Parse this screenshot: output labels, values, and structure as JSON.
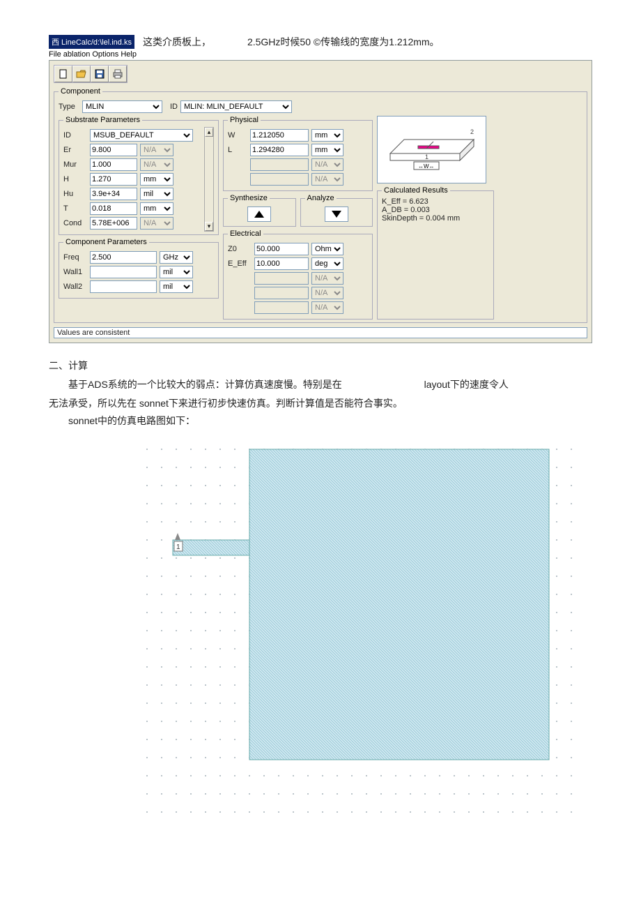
{
  "window": {
    "title": "西  LineCalc/d:\\lel.ind.ks",
    "caption_rest": "这类介质板上，",
    "caption_tail": "2.5GHz时候50 ©传输线的宽度为1.212mm。",
    "menubar": "File ablation Options Help"
  },
  "toolbar_icons": [
    "new-icon",
    "open-icon",
    "save-icon",
    "print-icon"
  ],
  "component": {
    "legend": "Component",
    "type_label": "Type",
    "type_value": "MLIN",
    "id_label": "ID",
    "id_value": "MLIN: MLIN_DEFAULT"
  },
  "substrate": {
    "legend": "Substrate Parameters",
    "id_label": "ID",
    "id_value": "MSUB_DEFAULT",
    "rows": [
      {
        "name": "Er",
        "value": "9.800",
        "unit": "N/A",
        "unit_disabled": true
      },
      {
        "name": "Mur",
        "value": "1.000",
        "unit": "N/A",
        "unit_disabled": true
      },
      {
        "name": "H",
        "value": "1.270",
        "unit": "mm",
        "unit_disabled": false
      },
      {
        "name": "Hu",
        "value": "3.9e+34",
        "unit": "mil",
        "unit_disabled": false
      },
      {
        "name": "T",
        "value": "0.018",
        "unit": "mm",
        "unit_disabled": false
      },
      {
        "name": "Cond",
        "value": "5.78E+006",
        "unit": "N/A",
        "unit_disabled": true
      }
    ]
  },
  "comp_params": {
    "legend": "Component Parameters",
    "rows": [
      {
        "name": "Freq",
        "value": "2.500",
        "unit": "GHz"
      },
      {
        "name": "Wall1",
        "value": "",
        "unit": "mil"
      },
      {
        "name": "Wall2",
        "value": "",
        "unit": "mil"
      }
    ]
  },
  "physical": {
    "legend": "Physical",
    "rows": [
      {
        "name": "W",
        "value": "1.212050",
        "unit": "mm",
        "disabled": false
      },
      {
        "name": "L",
        "value": "1.294280",
        "unit": "mm",
        "disabled": false
      },
      {
        "name": "",
        "value": "",
        "unit": "N/A",
        "disabled": true
      },
      {
        "name": "",
        "value": "",
        "unit": "N/A",
        "disabled": true
      }
    ]
  },
  "synth_legend": "Synthesize",
  "analyze_legend": "Analyze",
  "electrical": {
    "legend": "Electrical",
    "rows": [
      {
        "name": "Z0",
        "value": "50.000",
        "unit": "Ohm",
        "disabled": false
      },
      {
        "name": "E_Eff",
        "value": "10.000",
        "unit": "deg",
        "disabled": false
      },
      {
        "name": "",
        "value": "",
        "unit": "N/A",
        "disabled": true
      },
      {
        "name": "",
        "value": "",
        "unit": "N/A",
        "disabled": true
      },
      {
        "name": "",
        "value": "",
        "unit": "N/A",
        "disabled": true
      }
    ]
  },
  "results": {
    "legend": "Calculated Results",
    "lines": [
      "K_Eff = 6.623",
      "A_DB = 0.003",
      "SkinDepth = 0.004 mm"
    ]
  },
  "diagram_labels": {
    "one": "1",
    "two": "2",
    "w": "↔W↔"
  },
  "status": "Values are consistent",
  "body": {
    "h": "二、计算",
    "p1a": "基于ADS系统的一个比较大的弱点：计算仿真速度慢。特别是在",
    "p1b": "layout下的速度令人",
    "p2": "无法承受，所以先在 sonnet下来进行初步快速仿真。判断计算值是否能符合事实。",
    "p3": "sonnet中的仿真电路图如下："
  }
}
